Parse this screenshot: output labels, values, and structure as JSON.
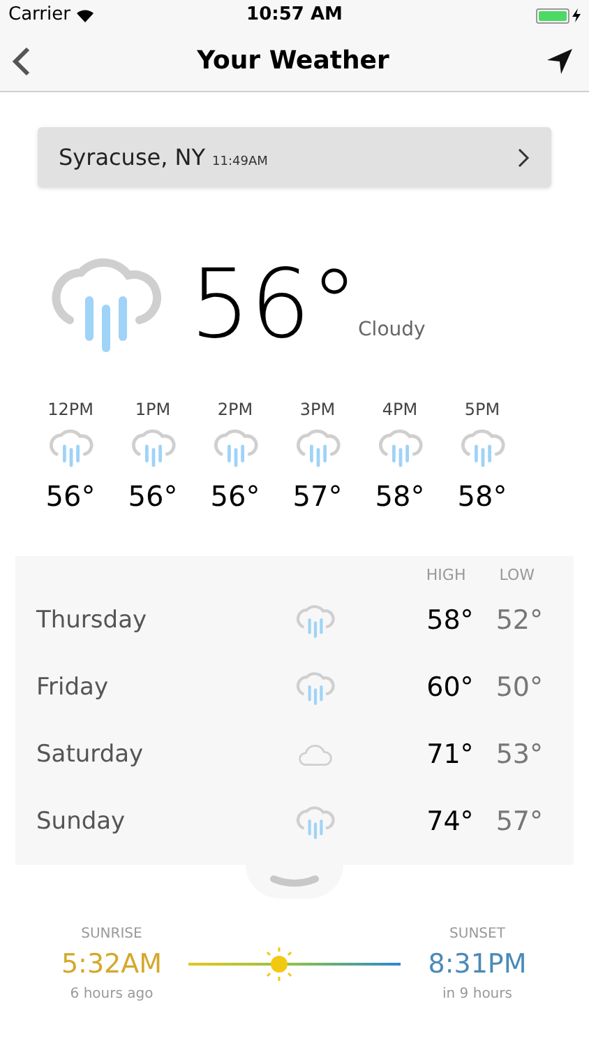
{
  "status_bar": {
    "carrier": "Carrier",
    "time": "10:57 AM"
  },
  "nav": {
    "title": "Your Weather"
  },
  "location": {
    "name": "Syracuse, NY",
    "time": "11:49AM"
  },
  "current": {
    "kind": "rain",
    "temperature": "56°",
    "condition": "Cloudy"
  },
  "hourly": [
    {
      "time": "12PM",
      "kind": "rain",
      "temperature": "56°"
    },
    {
      "time": "1PM",
      "kind": "rain",
      "temperature": "56°"
    },
    {
      "time": "2PM",
      "kind": "rain",
      "temperature": "56°"
    },
    {
      "time": "3PM",
      "kind": "rain",
      "temperature": "57°"
    },
    {
      "time": "4PM",
      "kind": "rain",
      "temperature": "58°"
    },
    {
      "time": "5PM",
      "kind": "rain",
      "temperature": "58°"
    }
  ],
  "forecast": {
    "columns": [
      "HIGH",
      "LOW"
    ],
    "days": [
      {
        "day": "Thursday",
        "kind": "rain",
        "high": "58°",
        "low": "52°"
      },
      {
        "day": "Friday",
        "kind": "rain",
        "high": "60°",
        "low": "50°"
      },
      {
        "day": "Saturday",
        "kind": "cloud",
        "high": "71°",
        "low": "53°"
      },
      {
        "day": "Sunday",
        "kind": "rain",
        "high": "74°",
        "low": "57°"
      }
    ]
  },
  "sun": {
    "sunrise_label": "SUNRISE",
    "sunrise": "5:32AM",
    "sunrise_note": "6 hours ago",
    "sunset_label": "SUNSET",
    "sunset": "8:31PM",
    "sunset_note": "in 9 hours",
    "level": 0.43
  }
}
